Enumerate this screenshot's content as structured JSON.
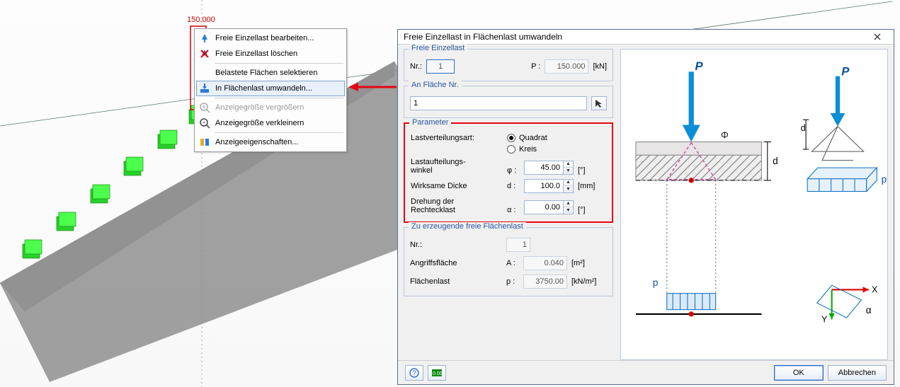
{
  "viewport": {
    "load_value_label": "150.000"
  },
  "context_menu": {
    "items": [
      {
        "label": "Freie Einzellast bearbeiten...",
        "icon": "edit-load-icon",
        "enabled": true
      },
      {
        "label": "Freie Einzellast löschen",
        "icon": "delete-load-icon",
        "enabled": true
      },
      {
        "label": "Belastete Flächen selektieren",
        "icon": "",
        "enabled": true
      },
      {
        "label": "In Flächenlast umwandeln...",
        "icon": "convert-load-icon",
        "enabled": true,
        "highlight": true
      },
      {
        "label": "Anzeigegröße vergrößern",
        "icon": "zoom-in-icon",
        "enabled": false
      },
      {
        "label": "Anzeigegröße verkleinern",
        "icon": "zoom-out-icon",
        "enabled": true
      },
      {
        "label": "Anzeigeeigenschaften...",
        "icon": "display-props-icon",
        "enabled": true
      }
    ]
  },
  "dialog": {
    "title": "Freie Einzellast in Flächenlast umwandeln",
    "group_point_load": {
      "title": "Freie Einzellast",
      "nr_label": "Nr.:",
      "nr_value": "1",
      "p_label": "P :",
      "p_value": "150.000",
      "p_unit": "[kN]"
    },
    "group_surface": {
      "title": "An Fläche Nr.",
      "value": "1"
    },
    "group_parameter": {
      "title": "Parameter",
      "dist_label": "Lastverteilungsart:",
      "radio_square": "Quadrat",
      "radio_circle": "Kreis",
      "angle_label1": "Lastaufteilungs-",
      "angle_label2": "winkel",
      "angle_sym": "φ :",
      "angle_value": "45.00",
      "angle_unit": "[°]",
      "thick_label": "Wirksame Dicke",
      "thick_sym": "d :",
      "thick_value": "100.0",
      "thick_unit": "[mm]",
      "rot_label1": "Drehung der",
      "rot_label2": "Rechtecklast",
      "rot_sym": "α :",
      "rot_value": "0.00",
      "rot_unit": "[°]"
    },
    "group_result": {
      "title": "Zu erzeugende freie Flächenlast",
      "nr_label": "Nr.:",
      "nr_value": "1",
      "area_label": "Angriffsfläche",
      "area_sym": "A :",
      "area_value": "0.040",
      "area_unit": "[m²]",
      "load_label": "Flächenlast",
      "load_sym": "p :",
      "load_value": "3750.00",
      "load_unit": "[kN/m²]"
    },
    "buttons": {
      "ok": "OK",
      "cancel": "Abbrechen"
    },
    "illustration": {
      "labels": {
        "P": "P",
        "phi": "Φ",
        "d": "d",
        "p": "p",
        "X": "X",
        "Y": "Y",
        "alpha": "α"
      }
    }
  }
}
